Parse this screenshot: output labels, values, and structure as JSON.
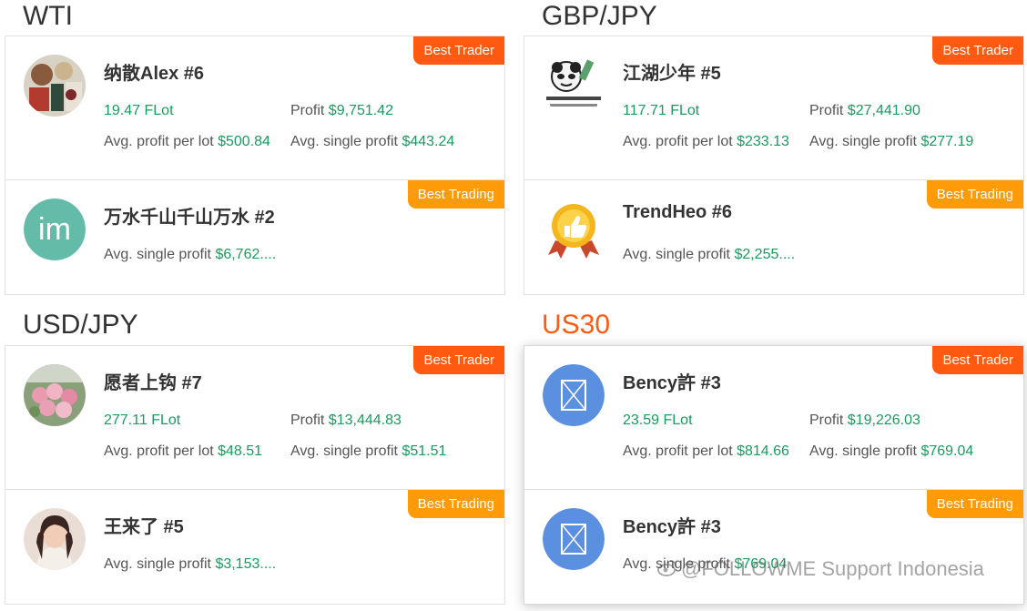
{
  "sections": [
    {
      "title": "WTI",
      "top_card": {
        "badge": "Best Trader",
        "name": "纳散Alex #6",
        "lots_value": "19.47",
        "lots_unit": " FLot",
        "profit_label": "Profit ",
        "profit_value": "$9,751.42",
        "ppl_label": "Avg. profit per lot ",
        "ppl_value": "$500.84",
        "asp_label": "Avg. single profit ",
        "asp_value": "$443.24"
      },
      "bottom_card": {
        "badge": "Best Trading",
        "name": "万水千山千山万水 #2",
        "avatar_text": "im",
        "asp_label": "Avg. single profit ",
        "asp_value": "$6,762...."
      }
    },
    {
      "title": "GBP/JPY",
      "top_card": {
        "badge": "Best Trader",
        "name": "江湖少年 #5",
        "lots_value": "117.71",
        "lots_unit": " FLot",
        "profit_label": "Profit ",
        "profit_value": "$27,441.90",
        "ppl_label": "Avg. profit per lot ",
        "ppl_value": "$233.13",
        "asp_label": "Avg. single profit ",
        "asp_value": "$277.19"
      },
      "bottom_card": {
        "badge": "Best Trading",
        "name": "TrendHeo #6",
        "asp_label": "Avg. single profit ",
        "asp_value": "$2,255...."
      }
    },
    {
      "title": "USD/JPY",
      "top_card": {
        "badge": "Best Trader",
        "name": "愿者上钩 #7",
        "lots_value": "277.11",
        "lots_unit": " FLot",
        "profit_label": "Profit ",
        "profit_value": "$13,444.83",
        "ppl_label": "Avg. profit per lot ",
        "ppl_value": "$48.51",
        "asp_label": "Avg. single profit ",
        "asp_value": "$51.51"
      },
      "bottom_card": {
        "badge": "Best Trading",
        "name": "王来了 #5",
        "asp_label": "Avg. single profit ",
        "asp_value": "$3,153...."
      }
    },
    {
      "title": "US30",
      "top_card": {
        "badge": "Best Trader",
        "name": "Bency許 #3",
        "lots_value": "23.59",
        "lots_unit": " FLot",
        "profit_label": "Profit ",
        "profit_value": "$19,226.03",
        "ppl_label": "Avg. profit per lot ",
        "ppl_value": "$814.66",
        "asp_label": "Avg. single profit ",
        "asp_value": "$769.04"
      },
      "bottom_card": {
        "badge": "Best Trading",
        "name": "Bency許 #3",
        "asp_label": "Avg. single profit ",
        "asp_value": "$769.04"
      }
    }
  ],
  "watermark": "@FOLLOWME Support Indonesia",
  "colors": {
    "accent_orange": "#ff5a0f",
    "badge_trading": "#ff9b08",
    "value_green": "#1a9b5f",
    "active_title": "#ff5a0f"
  },
  "icons": [
    "broken-image-icon",
    "thumbs-up-medal-icon",
    "weibo-logo-icon"
  ]
}
